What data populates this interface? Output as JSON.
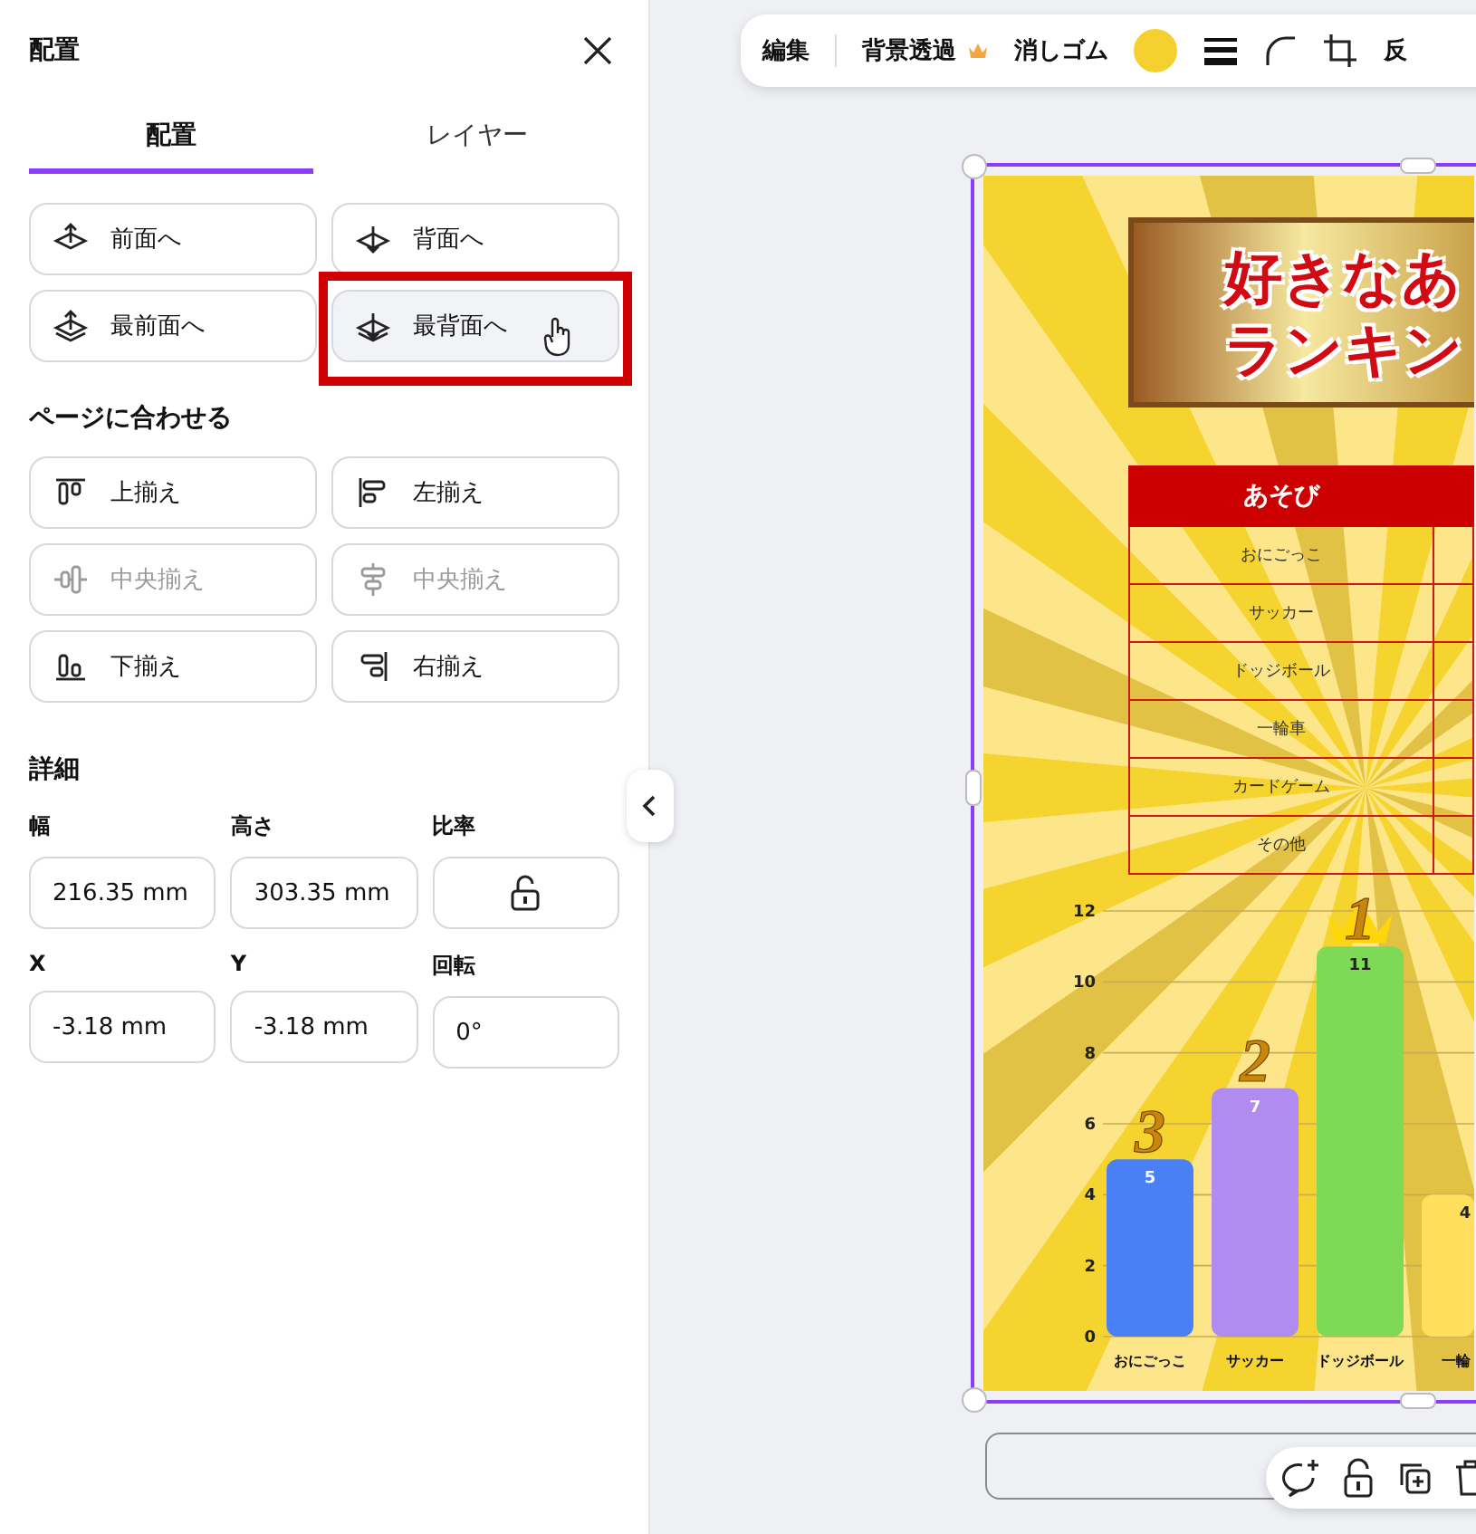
{
  "panel": {
    "title": "配置"
  },
  "tabs": [
    {
      "label": "配置",
      "selected": true
    },
    {
      "label": "レイヤー",
      "selected": false
    }
  ],
  "layer_buttons": [
    {
      "label": "前面へ",
      "hovered": false,
      "highlighted": false
    },
    {
      "label": "背面へ",
      "hovered": false,
      "highlighted": false
    },
    {
      "label": "最前面へ",
      "hovered": false,
      "highlighted": false
    },
    {
      "label": "最背面へ",
      "hovered": true,
      "highlighted": true
    }
  ],
  "align_section": {
    "title": "ページに合わせる",
    "buttons": [
      {
        "label": "上揃え",
        "disabled": false
      },
      {
        "label": "左揃え",
        "disabled": false
      },
      {
        "label": "中央揃え",
        "disabled": true
      },
      {
        "label": "中央揃え",
        "disabled": true
      },
      {
        "label": "下揃え",
        "disabled": false
      },
      {
        "label": "右揃え",
        "disabled": false
      }
    ]
  },
  "details": {
    "title": "詳細",
    "fields": [
      {
        "label": "幅",
        "kind": "input",
        "value": "216.35 mm"
      },
      {
        "label": "高さ",
        "kind": "input",
        "value": "303.35 mm"
      },
      {
        "label": "比率",
        "kind": "lock"
      },
      {
        "label": "X",
        "kind": "input",
        "value": "-3.18 mm"
      },
      {
        "label": "Y",
        "kind": "input",
        "value": "-3.18 mm"
      },
      {
        "label": "回転",
        "kind": "input",
        "value": "0°"
      }
    ]
  },
  "toolbar": [
    {
      "kind": "text",
      "label": "編集"
    },
    {
      "kind": "text",
      "label": "背景透過",
      "premium": true
    },
    {
      "kind": "text",
      "label": "消しゴム"
    },
    {
      "kind": "swatch",
      "color": "#f5d130"
    },
    {
      "kind": "text",
      "label": "反"
    }
  ],
  "design": {
    "title_lines": [
      "好きなあ",
      "ランキン"
    ],
    "table": {
      "header": "あそび",
      "rows": [
        "おにごっこ",
        "サッカー",
        "ドッジボール",
        "一輪車",
        "カードゲーム",
        "その他"
      ]
    },
    "chart_data": {
      "type": "bar",
      "categories": [
        "おにごっこ",
        "サッカー",
        "ドッジボール",
        "一輪"
      ],
      "series": [
        {
          "color": "#4a80f5",
          "values": [
            5,
            null,
            null,
            null
          ]
        },
        {
          "color": "#b08cf0",
          "values": [
            null,
            7,
            null,
            null
          ]
        },
        {
          "color": "#7ed957",
          "values": [
            null,
            null,
            11,
            null
          ]
        },
        {
          "color": "#ffdf5c",
          "values": [
            null,
            null,
            null,
            4
          ]
        }
      ],
      "grid": true,
      "ylim": [
        0,
        12
      ],
      "yticks": [
        0,
        2,
        4,
        6,
        8,
        10,
        12
      ],
      "data_labels": true,
      "annotations": [
        "3",
        "2",
        "1"
      ]
    }
  }
}
